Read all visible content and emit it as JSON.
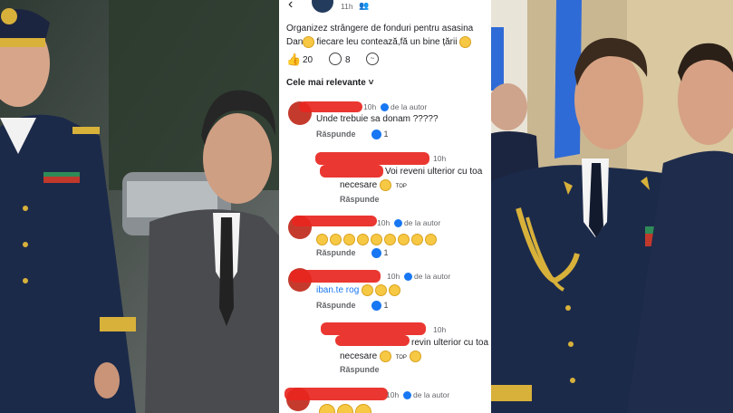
{
  "post": {
    "time": "11h",
    "text_line1": "Organizez strângere de fonduri pentru asasina",
    "text_line2_a": "Dan",
    "text_line2_b": "fiecare leu contează,fă un bine țării",
    "likes": "20",
    "comments": "8"
  },
  "sort_label": "Cele mai relevante",
  "comments": [
    {
      "time": "10h",
      "badge": "de la autor",
      "text": "Unde trebuie sa donam ?????",
      "reply": "Răspunde",
      "likes": "1"
    },
    {
      "time": "10h",
      "text_a": "Voi reveni",
      "text_b": " ulterior cu toa",
      "text_c": "necesare",
      "reply": "Răspunde",
      "top": "TOP"
    },
    {
      "time": "10h",
      "badge": "de la autor",
      "reply": "Răspunde",
      "likes": "1"
    },
    {
      "time": "10h",
      "badge": "de la autor",
      "text": "iban.te rog",
      "reply": "Răspunde",
      "likes": "1"
    },
    {
      "time": "10h",
      "text_a": "revin ulterior cu toa",
      "text_c": "necesare",
      "reply": "Răspunde",
      "top": "TOP"
    },
    {
      "time": "10h",
      "badge": "de la autor"
    }
  ],
  "icons": [
    "back-arrow-icon",
    "friends-icon",
    "like-icon",
    "comment-icon",
    "messenger-icon",
    "chevron-down-icon",
    "verified-badge-icon",
    "emoji-icon"
  ],
  "colors": {
    "accent": "#1877f2",
    "scribble": "#e8261f",
    "uniform": "#1c2a4a",
    "gold": "#d8b13a"
  }
}
